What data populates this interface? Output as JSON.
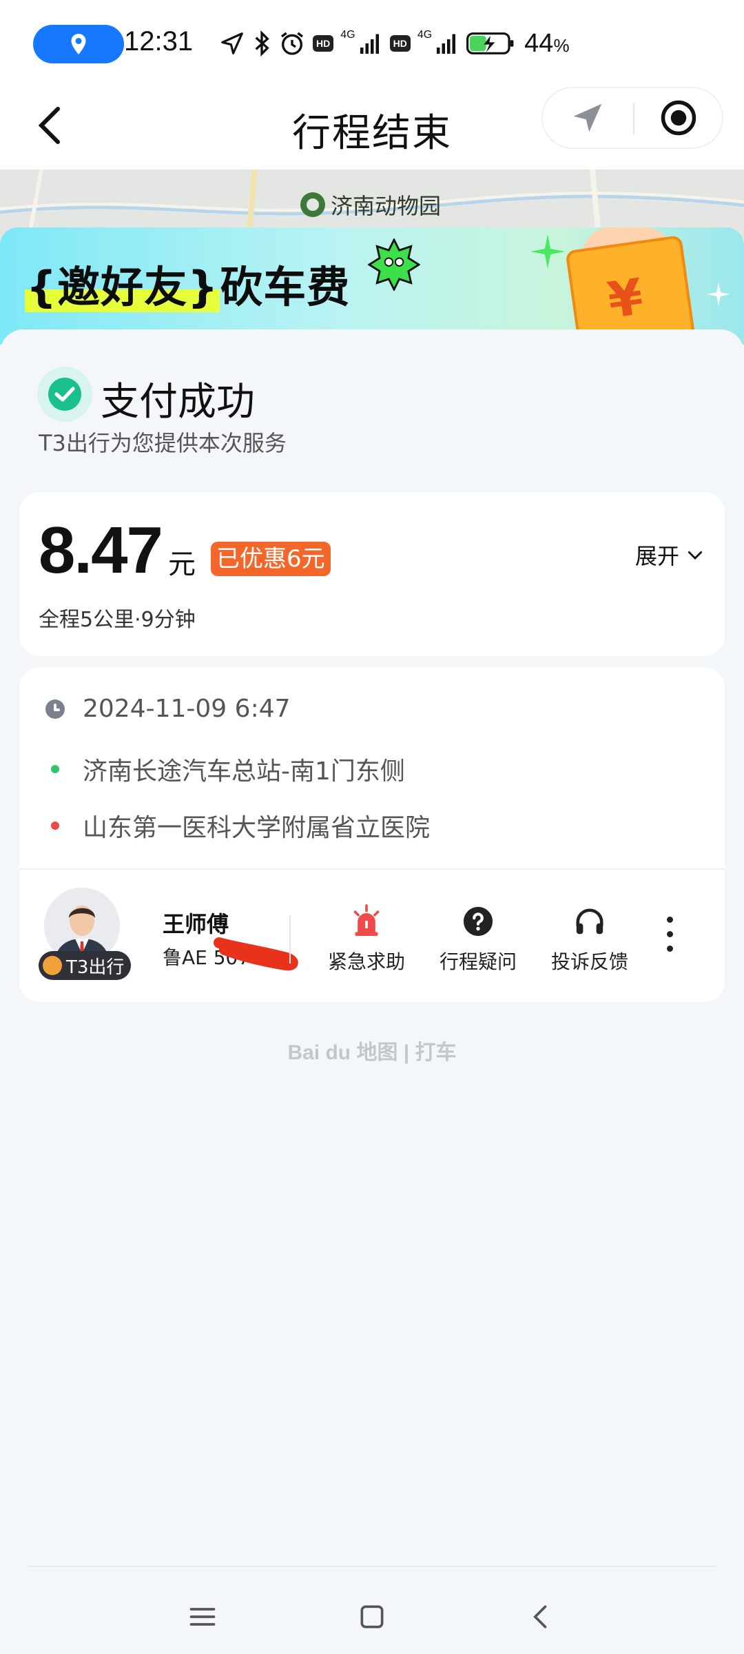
{
  "status_bar": {
    "time": "12:31",
    "network_1": "4G",
    "network_2": "4G",
    "hd_1": "HD",
    "hd_2": "HD",
    "battery_percent": "44",
    "battery_unit": "%"
  },
  "nav": {
    "title": "行程结束"
  },
  "map": {
    "poi_label": "济南动物园"
  },
  "banner": {
    "text_hl": "{邀好友}",
    "text_rest": "砍车费",
    "ticket_symbol": "¥"
  },
  "payment": {
    "status": "支付成功",
    "provider_note": "T3出行为您提供本次服务"
  },
  "fare": {
    "amount": "8.47",
    "unit": "元",
    "discount": "已优惠6元",
    "expand_label": "展开",
    "meta": "全程5公里·9分钟"
  },
  "trip": {
    "datetime": "2024-11-09 6:47",
    "origin": "济南长途汽车总站-南1门东侧",
    "destination": "山东第一医科大学附属省立医院"
  },
  "driver": {
    "name": "王师傅",
    "plate": "鲁AE  507",
    "brand": "T3出行"
  },
  "actions": [
    {
      "label": "紧急求助",
      "icon": "alarm-icon"
    },
    {
      "label": "行程疑问",
      "icon": "question-icon"
    },
    {
      "label": "投诉反馈",
      "icon": "headset-icon"
    }
  ],
  "watermark": "Bai du 地图 | 打车",
  "colors": {
    "accent_blue": "#1677ff",
    "success_green": "#19c08d",
    "discount_orange": "#f4672b",
    "alarm_red": "#f04a4a",
    "origin_green": "#36c46a",
    "dest_red": "#ef4a4a"
  }
}
